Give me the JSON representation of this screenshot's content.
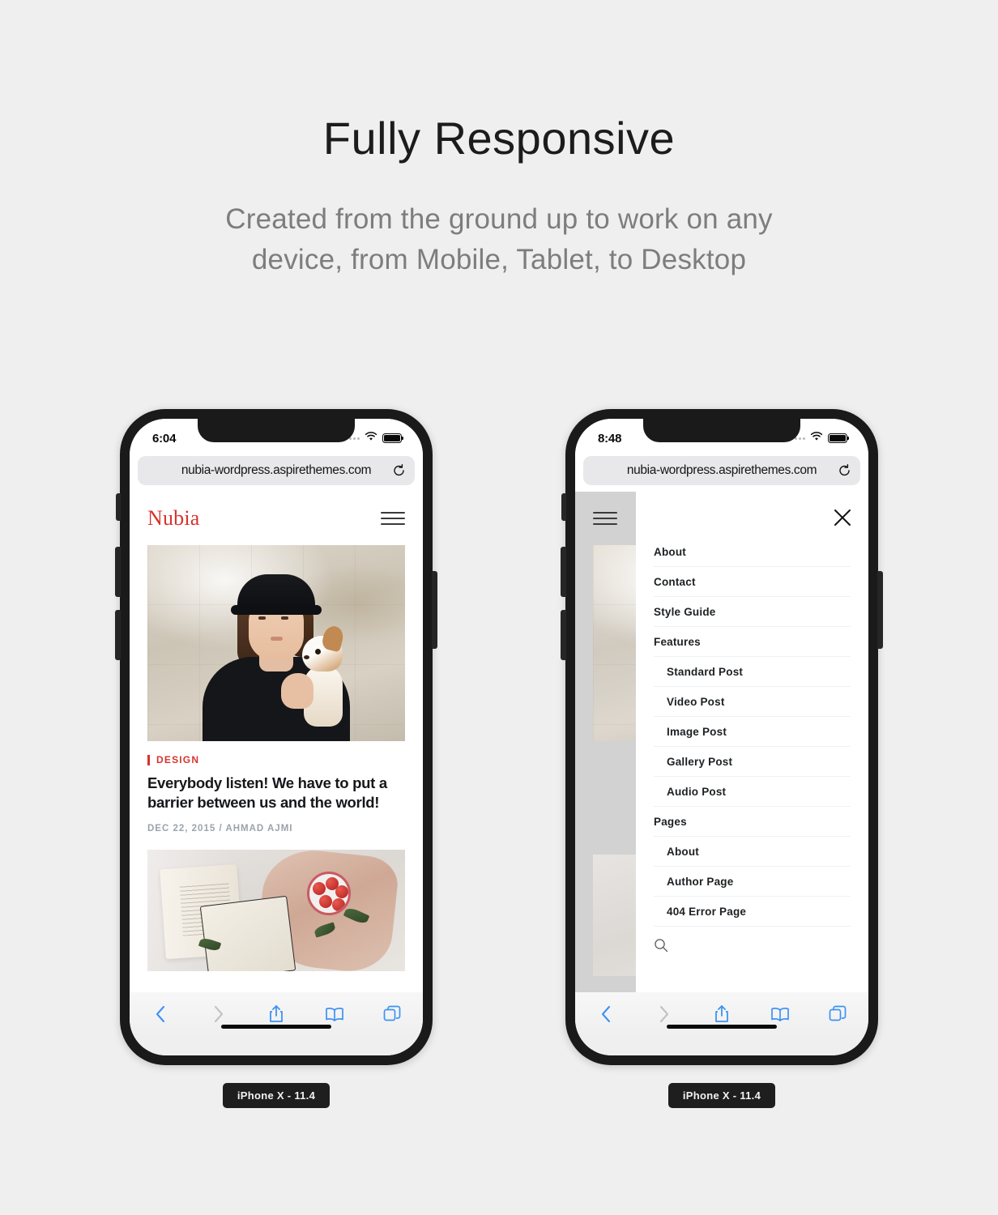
{
  "hero": {
    "title": "Fully Responsive",
    "subtitle_line1": "Created from the ground up to work on any",
    "subtitle_line2": "device, from Mobile, Tablet, to Desktop"
  },
  "colors": {
    "background": "#efefef",
    "brand_red": "#d6342c",
    "safari_blue": "#3d92f5",
    "text_dark": "#1c1c1c",
    "text_muted": "#7d7d7d"
  },
  "phone_left": {
    "device_label": "iPhone X - 11.4",
    "status": {
      "time": "6:04",
      "wifi_icon": "wifi-icon",
      "battery_icon": "battery-full-icon"
    },
    "browser": {
      "url": "nubia-wordpress.aspirethemes.com",
      "reload_icon": "reload-icon",
      "toolbar": {
        "back_icon": "chevron-left-icon",
        "forward_icon": "chevron-right-icon",
        "share_icon": "share-icon",
        "bookmarks_icon": "book-icon",
        "tabs_icon": "tabs-icon"
      }
    },
    "site": {
      "logo": "Nubia",
      "menu_icon": "hamburger-icon",
      "post": {
        "category": "DESIGN",
        "title": "Everybody listen! We have to put a barrier between us and the world!",
        "date": "DEC 22, 2015",
        "separator": "/",
        "author": "AHMAD AJMI"
      }
    }
  },
  "phone_right": {
    "device_label": "iPhone X - 11.4",
    "status": {
      "time": "8:48",
      "wifi_icon": "wifi-icon",
      "battery_icon": "battery-full-icon"
    },
    "browser": {
      "url": "nubia-wordpress.aspirethemes.com",
      "reload_icon": "reload-icon",
      "toolbar": {
        "back_icon": "chevron-left-icon",
        "forward_icon": "chevron-right-icon",
        "share_icon": "share-icon",
        "bookmarks_icon": "book-icon",
        "tabs_icon": "tabs-icon"
      }
    },
    "menu": {
      "close_icon": "close-icon",
      "search_icon": "search-icon",
      "items": [
        {
          "label": "About",
          "level": 0
        },
        {
          "label": "Contact",
          "level": 0
        },
        {
          "label": "Style Guide",
          "level": 0
        },
        {
          "label": "Features",
          "level": 0
        },
        {
          "label": "Standard Post",
          "level": 1
        },
        {
          "label": "Video Post",
          "level": 1
        },
        {
          "label": "Image Post",
          "level": 1
        },
        {
          "label": "Gallery Post",
          "level": 1
        },
        {
          "label": "Audio Post",
          "level": 1
        },
        {
          "label": "Pages",
          "level": 0
        },
        {
          "label": "About",
          "level": 1
        },
        {
          "label": "Author Page",
          "level": 1
        },
        {
          "label": "404 Error Page",
          "level": 1
        }
      ]
    }
  }
}
